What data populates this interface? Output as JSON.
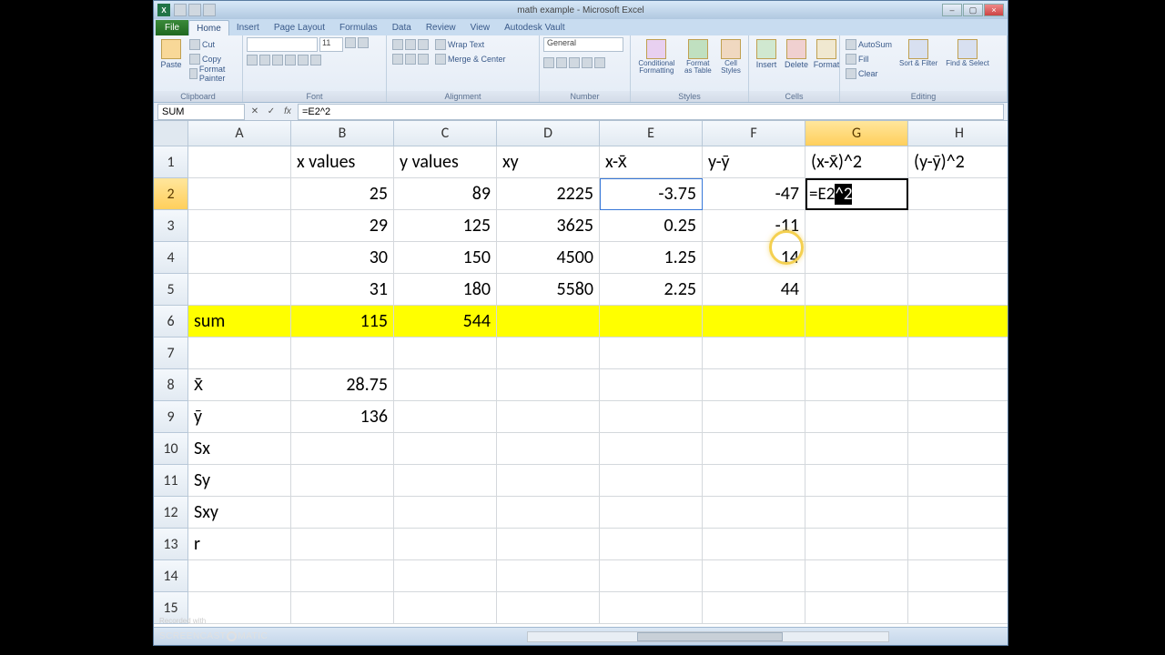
{
  "app": {
    "title": "math example - Microsoft Excel"
  },
  "tabs": {
    "file": "File",
    "items": [
      "Home",
      "Insert",
      "Page Layout",
      "Formulas",
      "Data",
      "Review",
      "View",
      "Autodesk Vault"
    ],
    "active": "Home"
  },
  "ribbon": {
    "clipboard": {
      "label": "Clipboard",
      "paste": "Paste",
      "cut": "Cut",
      "copy": "Copy",
      "fmtpaint": "Format Painter"
    },
    "font": {
      "label": "Font",
      "size": "11"
    },
    "alignment": {
      "label": "Alignment",
      "wrap": "Wrap Text",
      "merge": "Merge & Center"
    },
    "number": {
      "label": "Number",
      "format": "General"
    },
    "styles": {
      "label": "Styles",
      "cond": "Conditional Formatting",
      "table": "Format as Table",
      "cellstyles": "Cell Styles"
    },
    "cells": {
      "label": "Cells",
      "insert": "Insert",
      "delete": "Delete",
      "format": "Format"
    },
    "editing": {
      "label": "Editing",
      "autosum": "AutoSum",
      "fill": "Fill",
      "clear": "Clear",
      "sort": "Sort & Filter",
      "find": "Find & Select"
    }
  },
  "namebox": "SUM",
  "formula": "=E2^2",
  "columns": [
    "A",
    "B",
    "C",
    "D",
    "E",
    "F",
    "G",
    "H"
  ],
  "rows_visible": 15,
  "active_cell": "G2",
  "headers": {
    "B1": "x values",
    "C1": "y values",
    "D1": "xy",
    "E1": "x-x̄",
    "F1": "y-ȳ",
    "G1": "(x-x̄)^2",
    "H1": "(y-ȳ)^2"
  },
  "cells": {
    "B2": "25",
    "C2": "89",
    "D2": "2225",
    "E2": "-3.75",
    "F2": "-47",
    "G2_edit": "=E2^2",
    "B3": "29",
    "C3": "125",
    "D3": "3625",
    "E3": "0.25",
    "F3": "-11",
    "B4": "30",
    "C4": "150",
    "D4": "4500",
    "E4": "1.25",
    "F4": "14",
    "B5": "31",
    "C5": "180",
    "D5": "5580",
    "E5": "2.25",
    "F5": "44",
    "A6": "sum",
    "B6": "115",
    "C6": "544",
    "A8": "x̄",
    "B8": "28.75",
    "A9": "ȳ",
    "B9": "136",
    "A10": "Sx",
    "A11": "Sy",
    "A12": "Sxy",
    "A13": "r"
  },
  "watermark": {
    "rec": "Recorded with",
    "brand_a": "SCREENCAST",
    "brand_b": "MATIC"
  }
}
